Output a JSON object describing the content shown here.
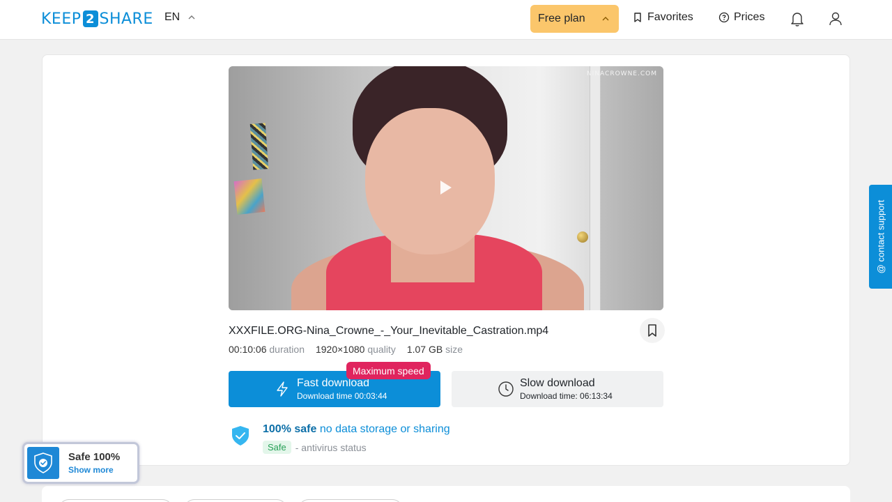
{
  "header": {
    "logo_left": "KEEP",
    "logo_mid": "2",
    "logo_right": "SHARE",
    "language": "EN",
    "plan_label": "Free plan",
    "favorites_label": "Favorites",
    "prices_label": "Prices"
  },
  "video": {
    "watermark": "NINACROWNE.COM"
  },
  "file": {
    "name": "XXXFILE.ORG-Nina_Crowne_-_Your_Inevitable_Castration.mp4",
    "duration": "00:10:06",
    "duration_label": "duration",
    "quality": "1920×1080",
    "quality_label": "quality",
    "size": "1.07 GB",
    "size_label": "size"
  },
  "download": {
    "badge": "Maximum speed",
    "fast_title": "Fast download",
    "fast_sub": "Download time 00:03:44",
    "slow_title": "Slow download",
    "slow_sub": "Download time: 06:13:34"
  },
  "safety": {
    "strong": "100% safe",
    "link": "no data storage or sharing",
    "status_badge": "Safe",
    "status_text": "- antivirus status"
  },
  "support": {
    "label": "@ contact support"
  },
  "widget": {
    "title": "Safe 100%",
    "more": "Show more"
  },
  "colors": {
    "brand": "#0c8ed8",
    "plan": "#fbc66b",
    "badge": "#e0245e"
  }
}
